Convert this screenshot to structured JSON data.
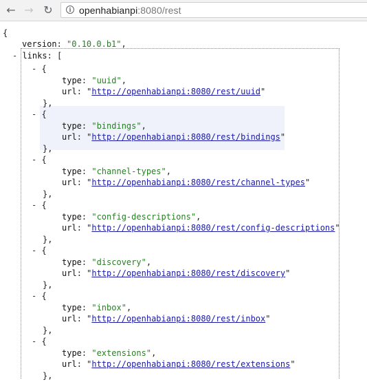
{
  "browser": {
    "back_icon": "←",
    "forward_icon": "→",
    "reload_icon": "↻",
    "info_glyph": "i",
    "url_host": "openhabianpi",
    "url_rest": ":8080/rest"
  },
  "json": {
    "open_brace": "{",
    "version_key": "version",
    "version_value": "\"0.10.0.b1\"",
    "links_key": "links",
    "links": [
      {
        "type": "uuid",
        "url": "http://openhabianpi:8080/rest/uuid"
      },
      {
        "type": "bindings",
        "url": "http://openhabianpi:8080/rest/bindings"
      },
      {
        "type": "channel-types",
        "url": "http://openhabianpi:8080/rest/channel-types"
      },
      {
        "type": "config-descriptions",
        "url": "http://openhabianpi:8080/rest/config-descriptions"
      },
      {
        "type": "discovery",
        "url": "http://openhabianpi:8080/rest/discovery"
      },
      {
        "type": "inbox",
        "url": "http://openhabianpi:8080/rest/inbox"
      },
      {
        "type": "extensions",
        "url": "http://openhabianpi:8080/rest/extensions"
      }
    ]
  }
}
